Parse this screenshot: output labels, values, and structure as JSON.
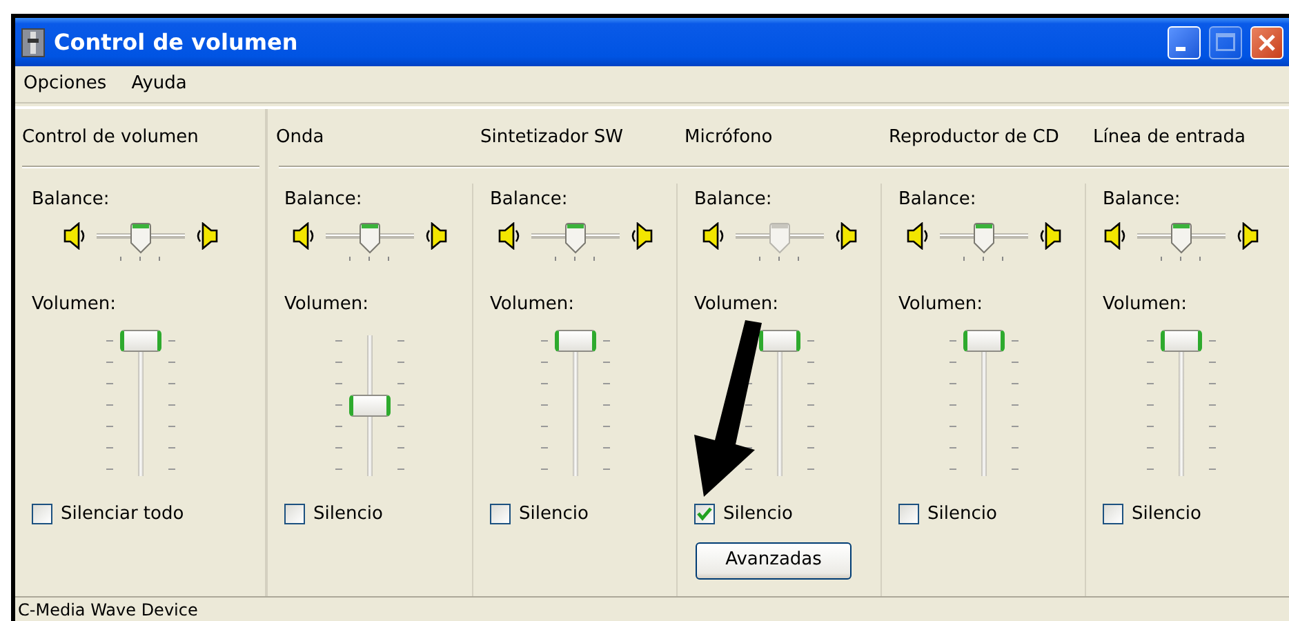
{
  "window": {
    "title": "Control de volumen"
  },
  "title_buttons": [
    {
      "kind": "minimize",
      "disabled": false
    },
    {
      "kind": "maximize",
      "disabled": true
    },
    {
      "kind": "close",
      "disabled": false
    }
  ],
  "menu": [
    "Opciones",
    "Ayuda"
  ],
  "channels": [
    {
      "kind": "master",
      "name": "Control de volumen",
      "balance_label": "Balance:",
      "balance": {
        "level": 0.5,
        "disabled": false
      },
      "volume_label": "Volumen:",
      "volume": {
        "level": 1
      },
      "mute": {
        "label": "Silenciar todo",
        "checked": false
      }
    },
    {
      "kind": "line",
      "name": "Onda",
      "balance_label": "Balance:",
      "balance": {
        "level": 0.5,
        "disabled": false
      },
      "volume_label": "Volumen:",
      "volume": {
        "level": 0.5
      },
      "mute": {
        "label": "Silencio",
        "checked": false
      }
    },
    {
      "kind": "line",
      "name": "Sintetizador SW",
      "balance_label": "Balance:",
      "balance": {
        "level": 0.5,
        "disabled": false
      },
      "volume_label": "Volumen:",
      "volume": {
        "level": 1
      },
      "mute": {
        "label": "Silencio",
        "checked": false
      }
    },
    {
      "kind": "line",
      "name": "Micrófono",
      "balance_label": "Balance:",
      "balance": {
        "level": 0.5,
        "disabled": true
      },
      "volume_label": "Volumen:",
      "volume": {
        "level": 1
      },
      "mute": {
        "label": "Silencio",
        "checked": true
      },
      "button": "Avanzadas"
    },
    {
      "kind": "line",
      "name": "Reproductor de CD",
      "balance_label": "Balance:",
      "balance": {
        "level": 0.5,
        "disabled": false
      },
      "volume_label": "Volumen:",
      "volume": {
        "level": 1
      },
      "mute": {
        "label": "Silencio",
        "checked": false
      }
    },
    {
      "kind": "line",
      "name": "Línea de entrada",
      "balance_label": "Balance:",
      "balance": {
        "level": 0.5,
        "disabled": false
      },
      "volume_label": "Volumen:",
      "volume": {
        "level": 1
      },
      "mute": {
        "label": "Silencio",
        "checked": false
      }
    }
  ],
  "status_bar": "C-Media Wave Device"
}
